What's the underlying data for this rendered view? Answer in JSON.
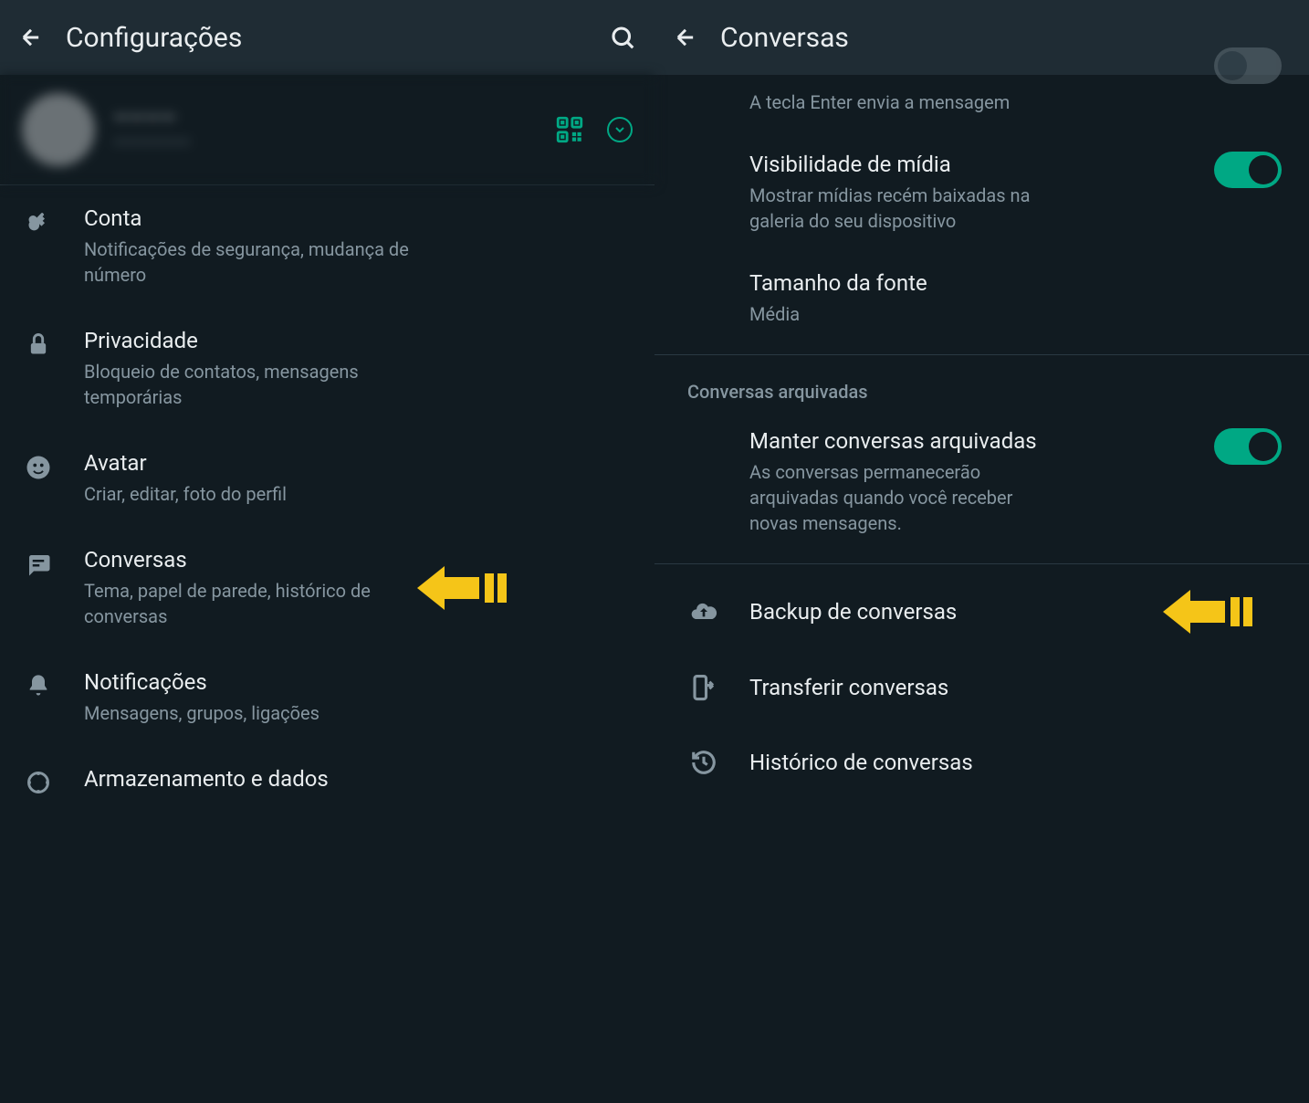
{
  "left": {
    "header_title": "Configurações",
    "profile": {
      "name": "————",
      "status": "——————"
    },
    "items": [
      {
        "title": "Conta",
        "subtitle": "Notificações de segurança, mudança de número"
      },
      {
        "title": "Privacidade",
        "subtitle": "Bloqueio de contatos, mensagens temporárias"
      },
      {
        "title": "Avatar",
        "subtitle": "Criar, editar, foto do perfil"
      },
      {
        "title": "Conversas",
        "subtitle": "Tema, papel de parede, histórico de conversas"
      },
      {
        "title": "Notificações",
        "subtitle": "Mensagens, grupos, ligações"
      },
      {
        "title": "Armazenamento e dados",
        "subtitle": ""
      }
    ]
  },
  "right": {
    "header_title": "Conversas",
    "enter_subtitle": "A tecla Enter envia a mensagem",
    "media": {
      "title": "Visibilidade de mídia",
      "subtitle": "Mostrar mídias recém baixadas na galeria do seu dispositivo"
    },
    "font": {
      "title": "Tamanho da fonte",
      "subtitle": "Média"
    },
    "archived_section": "Conversas arquivadas",
    "keep_archived": {
      "title": "Manter conversas arquivadas",
      "subtitle": "As conversas permanecerão arquivadas quando você receber novas mensagens."
    },
    "backup": "Backup de conversas",
    "transfer": "Transferir conversas",
    "history": "Histórico de conversas"
  }
}
